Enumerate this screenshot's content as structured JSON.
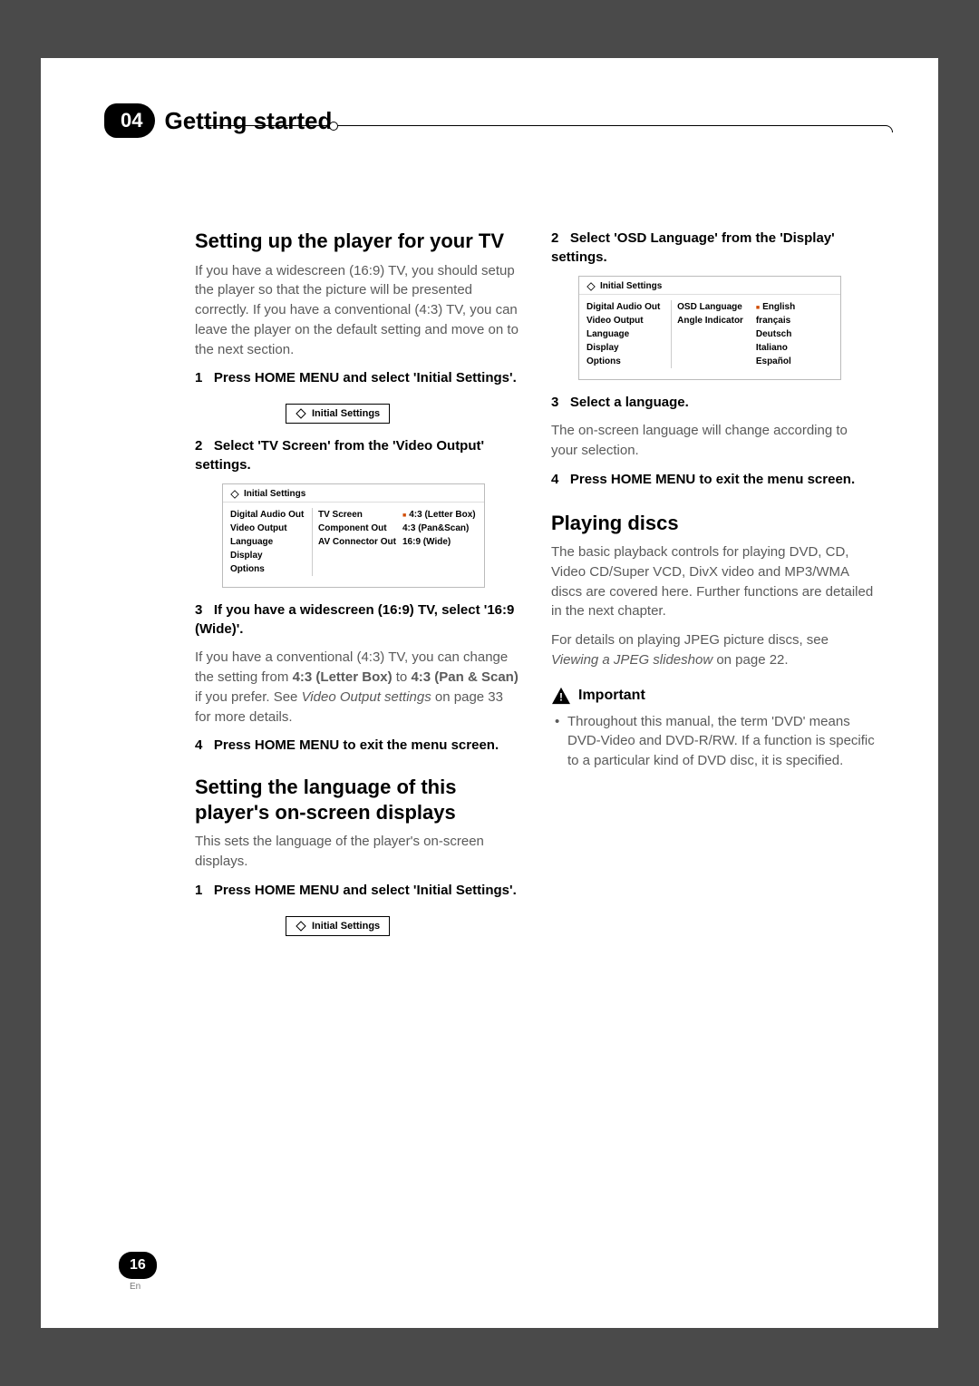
{
  "chapter": {
    "number": "04",
    "title": "Getting started"
  },
  "left": {
    "h_setup": "Setting up the player for your TV",
    "setup_intro": "If you have a widescreen (16:9) TV, you should setup the player so that the picture will be presented correctly. If you have a conventional (4:3) TV, you can leave the player on the default setting and move on to the next section.",
    "step1_prefix": "1",
    "step1_text": "Press HOME MENU and select 'Initial Settings'.",
    "chip_label": "Initial Settings",
    "step2_prefix": "2",
    "step2_text": "Select 'TV Screen' from the 'Video Output' settings.",
    "osd1": {
      "title": "Initial Settings",
      "colA": [
        "Digital Audio Out",
        "Video Output",
        "Language",
        "Display",
        "Options"
      ],
      "colB": [
        "TV Screen",
        "Component Out",
        "AV Connector Out"
      ],
      "colC": [
        "4:3 (Letter Box)",
        "4:3 (Pan&Scan)",
        "16:9 (Wide)"
      ]
    },
    "step3_prefix": "3",
    "step3_text": "If you have a widescreen (16:9) TV, select '16:9 (Wide)'.",
    "step3_body_a": "If you have a conventional (4:3) TV, you can change the setting from ",
    "step3_body_b": "4:3 (Letter Box)",
    "step3_body_c": " to ",
    "step3_body_d": "4:3 (Pan & Scan)",
    "step3_body_e": " if you prefer. See ",
    "step3_body_f": "Video Output settings",
    "step3_body_g": " on page 33 for more details.",
    "step4_prefix": "4",
    "step4_text": "Press HOME MENU to exit the menu screen.",
    "h_lang": "Setting the language of this player's on-screen displays",
    "lang_intro": "This sets the language of the player's on-screen displays.",
    "lang_step1_prefix": "1",
    "lang_step1_text": "Press HOME MENU and select 'Initial Settings'."
  },
  "right": {
    "step2_prefix": "2",
    "step2_text": "Select 'OSD Language' from the 'Display' settings.",
    "osd2": {
      "title": "Initial Settings",
      "colA": [
        "Digital Audio Out",
        "Video Output",
        "Language",
        "Display",
        "Options"
      ],
      "colB": [
        "OSD Language",
        "Angle Indicator"
      ],
      "colC": [
        "English",
        "français",
        "Deutsch",
        "Italiano",
        "Español"
      ]
    },
    "step3_prefix": "3",
    "step3_text": "Select a language.",
    "step3_body": "The on-screen language will change according to your selection.",
    "step4_prefix": "4",
    "step4_text": "Press HOME MENU to exit the menu screen.",
    "h_play": "Playing discs",
    "play_p1": "The basic playback controls for playing DVD, CD, Video CD/Super VCD, DivX video and MP3/WMA discs are covered here. Further functions are detailed in the next chapter.",
    "play_p2a": "For details on playing JPEG picture discs, see ",
    "play_p2b": "Viewing a JPEG slideshow",
    "play_p2c": " on page 22.",
    "important_label": "Important",
    "important_item": "Throughout this manual, the term 'DVD' means DVD-Video and DVD-R/RW. If a function is specific to a particular kind of DVD disc, it is specified."
  },
  "footer": {
    "page": "16",
    "lang": "En"
  }
}
